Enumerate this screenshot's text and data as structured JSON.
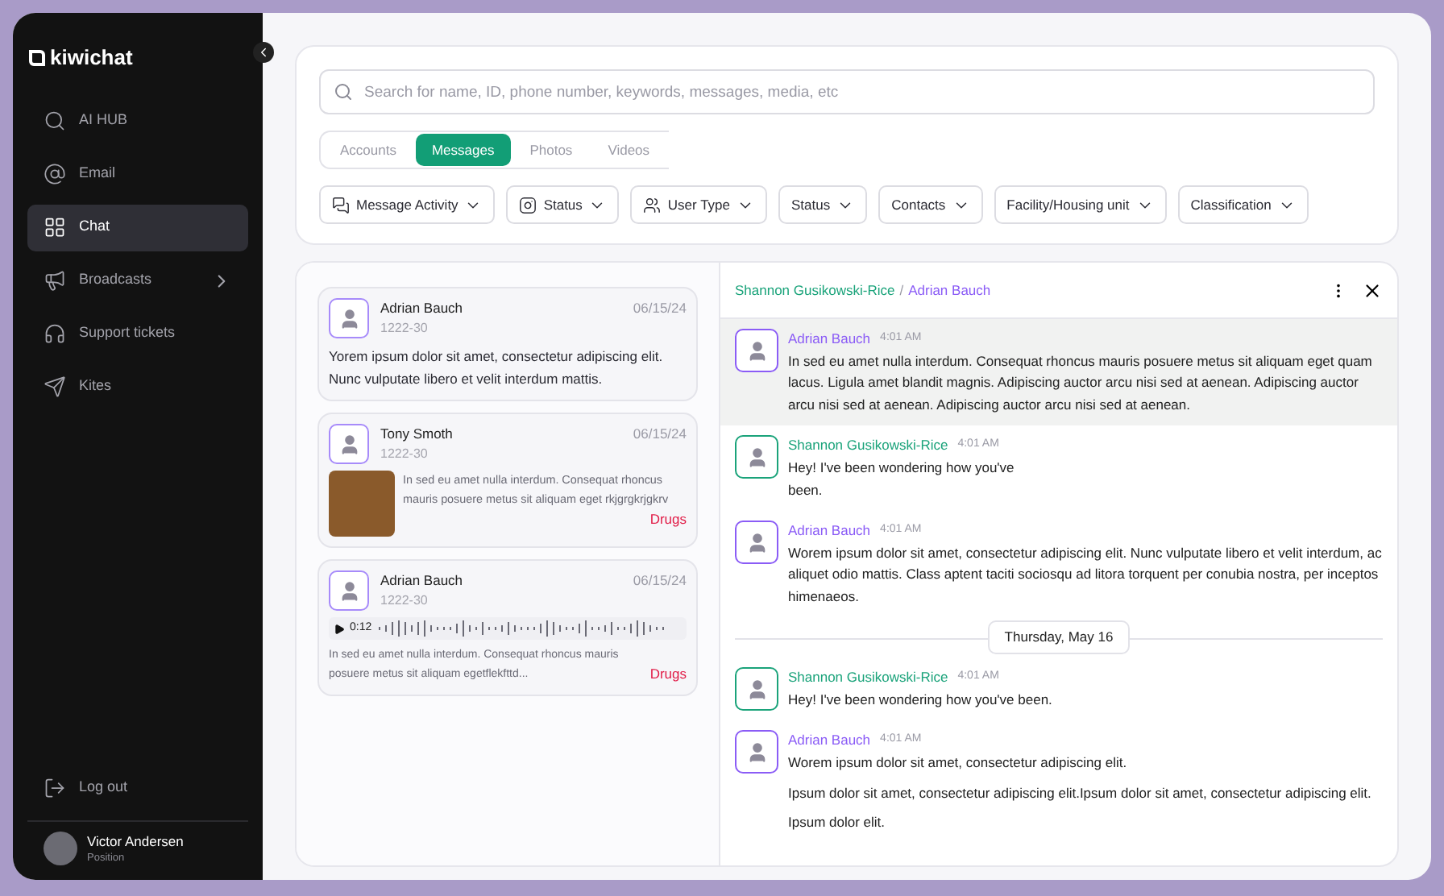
{
  "brand": "kiwichat",
  "sidebar": {
    "items": [
      {
        "label": "AI HUB",
        "selected": false,
        "expandable": false
      },
      {
        "label": "Email",
        "selected": false,
        "expandable": false
      },
      {
        "label": "Chat",
        "selected": true,
        "expandable": false
      },
      {
        "label": "Broadcasts",
        "selected": false,
        "expandable": true
      },
      {
        "label": "Support tickets",
        "selected": false,
        "expandable": false
      },
      {
        "label": "Kites",
        "selected": false,
        "expandable": false
      }
    ],
    "logout": "Log out",
    "user": {
      "name": "Victor Andersen",
      "role": "Position"
    }
  },
  "search": {
    "placeholder": "Search for name, ID, phone number, keywords, messages, media, etc"
  },
  "tabs": [
    {
      "label": "Accounts",
      "selected": false
    },
    {
      "label": "Messages",
      "selected": true
    },
    {
      "label": "Photos",
      "selected": false
    },
    {
      "label": "Videos",
      "selected": false
    }
  ],
  "filters": [
    "Message Activity",
    "Status",
    "User Type",
    "Status",
    "Contacts",
    "Facility/Housing unit",
    "Classification"
  ],
  "conversations": [
    {
      "kind": "text",
      "name": "Adrian Bauch",
      "id": "1222-30",
      "date": "06/15/24",
      "text": "Yorem ipsum dolor sit amet, consectetur adipiscing elit. Nunc vulputate libero et velit interdum mattis."
    },
    {
      "kind": "image",
      "name": "Tony Smoth",
      "id": "1222-30",
      "date": "06/15/24",
      "text": "In sed eu amet nulla interdum. Consequat rhoncus mauris posuere metus sit aliquam eget rkjgrgkrjgkrv",
      "tag": "Drugs"
    },
    {
      "kind": "audio",
      "name": "Adrian Bauch",
      "id": "1222-30",
      "date": "06/15/24",
      "duration": "0:12",
      "text": "In sed eu amet nulla interdum. Consequat rhoncus mauris posuere metus sit aliquam egetflekfttd...",
      "tag": "Drugs"
    }
  ],
  "chat": {
    "header": {
      "left": "Shannon Gusikowski-Rice",
      "separator": "/",
      "right": "Adrian Bauch"
    },
    "items": [
      {
        "kind": "message",
        "color": "#8b5cf6",
        "sender": "Adrian Bauch",
        "time": "4:01 AM",
        "highlighted": true,
        "paragraphs": [
          "In sed eu amet nulla interdum. Consequat rhoncus mauris posuere metus sit aliquam eget quam lacus. Ligula amet blandit magnis. Adipiscing auctor arcu nisi sed at aenean. Adipiscing auctor arcu nisi sed at aenean. Adipiscing auctor arcu nisi sed at aenean."
        ]
      },
      {
        "kind": "message",
        "color": "#1aa37a",
        "sender": "Shannon Gusikowski-Rice",
        "time": "4:01 AM",
        "highlighted": false,
        "narrow": true,
        "paragraphs": [
          "Hey! I've been wondering how you've been."
        ]
      },
      {
        "kind": "message",
        "color": "#8b5cf6",
        "sender": "Adrian Bauch",
        "time": "4:01 AM",
        "highlighted": false,
        "paragraphs": [
          "Worem ipsum dolor sit amet, consectetur adipiscing elit. Nunc vulputate libero et velit interdum, ac aliquet odio mattis. Class aptent taciti sociosqu ad litora torquent per conubia nostra, per inceptos himenaeos."
        ]
      },
      {
        "kind": "date",
        "label": "Thursday, May 16"
      },
      {
        "kind": "message",
        "color": "#1aa37a",
        "sender": "Shannon Gusikowski-Rice",
        "time": "4:01 AM",
        "highlighted": false,
        "paragraphs": [
          "Hey! I've been wondering how you've been."
        ]
      },
      {
        "kind": "message",
        "color": "#8b5cf6",
        "sender": "Adrian Bauch",
        "time": "4:01 AM",
        "highlighted": false,
        "paragraphs": [
          "Worem ipsum dolor sit amet, consectetur adipiscing elit.",
          "Ipsum dolor sit amet, consectetur adipiscing elit.Ipsum dolor sit amet, consectetur adipiscing elit.",
          "Ipsum dolor elit."
        ]
      }
    ]
  }
}
